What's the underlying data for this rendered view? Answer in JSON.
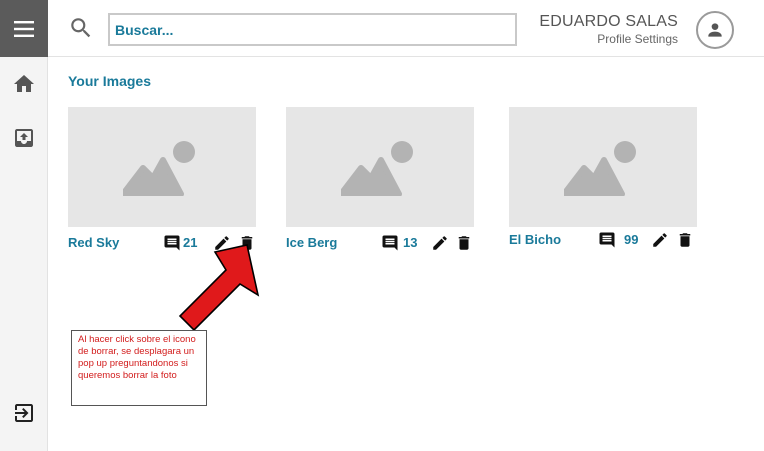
{
  "search": {
    "placeholder": "Buscar..."
  },
  "user": {
    "name": "EDUARDO SALAS",
    "profile_link": "Profile Settings"
  },
  "sidebar": {
    "icons": [
      "menu-icon",
      "home-icon",
      "upload-icon",
      "logout-icon"
    ]
  },
  "main": {
    "title": "Your Images",
    "images": [
      {
        "title": "Red Sky",
        "comments": "21"
      },
      {
        "title": "Ice Berg",
        "comments": "13"
      },
      {
        "title": "El Bicho",
        "comments": "99"
      }
    ]
  },
  "annotation": {
    "text": "Al hacer click sobre el icono de borrar, se desplagara un pop up preguntandonos si queremos borrar la foto"
  },
  "colors": {
    "accent": "#1a7a9a",
    "sidebar_menu": "#5b5b5b",
    "annotation_red": "#e0191b"
  }
}
